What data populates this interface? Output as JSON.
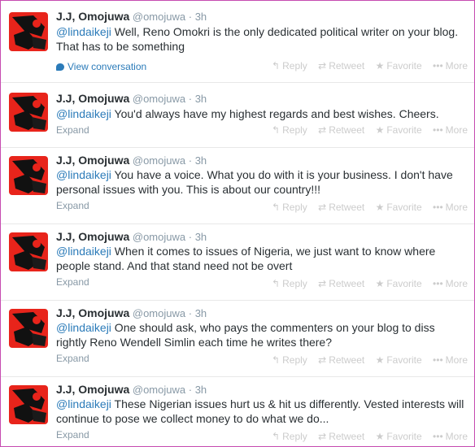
{
  "tweets": [
    {
      "name": "J.J, Omojuwa",
      "handle": "@omojuwa",
      "sep": "·",
      "time": "3h",
      "mention": "@lindaikeji",
      "text": " Well, Reno Omokri is the only dedicated political writer on your blog. That has to be something",
      "footer": "View conversation"
    },
    {
      "name": "J.J, Omojuwa",
      "handle": "@omojuwa",
      "sep": "·",
      "time": "3h",
      "mention": "@lindaikeji",
      "text": " You'd always have my highest regards and best wishes. Cheers.",
      "footer": "Expand"
    },
    {
      "name": "J.J, Omojuwa",
      "handle": "@omojuwa",
      "sep": "·",
      "time": "3h",
      "mention": "@lindaikeji",
      "text": " You have a voice. What you do with it is your business. I don't have personal issues with you. This is about our country!!!",
      "footer": "Expand"
    },
    {
      "name": "J.J, Omojuwa",
      "handle": "@omojuwa",
      "sep": "·",
      "time": "3h",
      "mention": "@lindaikeji",
      "text": " When it comes to issues of Nigeria, we just want to know where people stand. And that stand need not be overt",
      "footer": "Expand"
    },
    {
      "name": "J.J, Omojuwa",
      "handle": "@omojuwa",
      "sep": "·",
      "time": "3h",
      "mention": "@lindaikeji",
      "text": " One should ask, who pays the commenters on your blog to diss rightly Reno Wendell Simlin each time he writes there?",
      "footer": "Expand"
    },
    {
      "name": "J.J, Omojuwa",
      "handle": "@omojuwa",
      "sep": "·",
      "time": "3h",
      "mention": "@lindaikeji",
      "text": " These Nigerian issues hurt us & hit us differently. Vested interests will continue to pose we collect money to do what we do...",
      "footer": "Expand"
    }
  ],
  "actions": {
    "reply": "Reply",
    "retweet": "Retweet",
    "favorite": "Favorite",
    "more": "More"
  },
  "icons": {
    "reply": "reply-arrow-icon",
    "retweet": "retweet-arrows-icon",
    "favorite": "star-icon",
    "more": "ellipsis-icon",
    "conversation": "speech-bubble-icon"
  },
  "colors": {
    "border": "#c64bb0",
    "mention": "#2b7bb9",
    "avatar_bg": "#e8241b"
  }
}
